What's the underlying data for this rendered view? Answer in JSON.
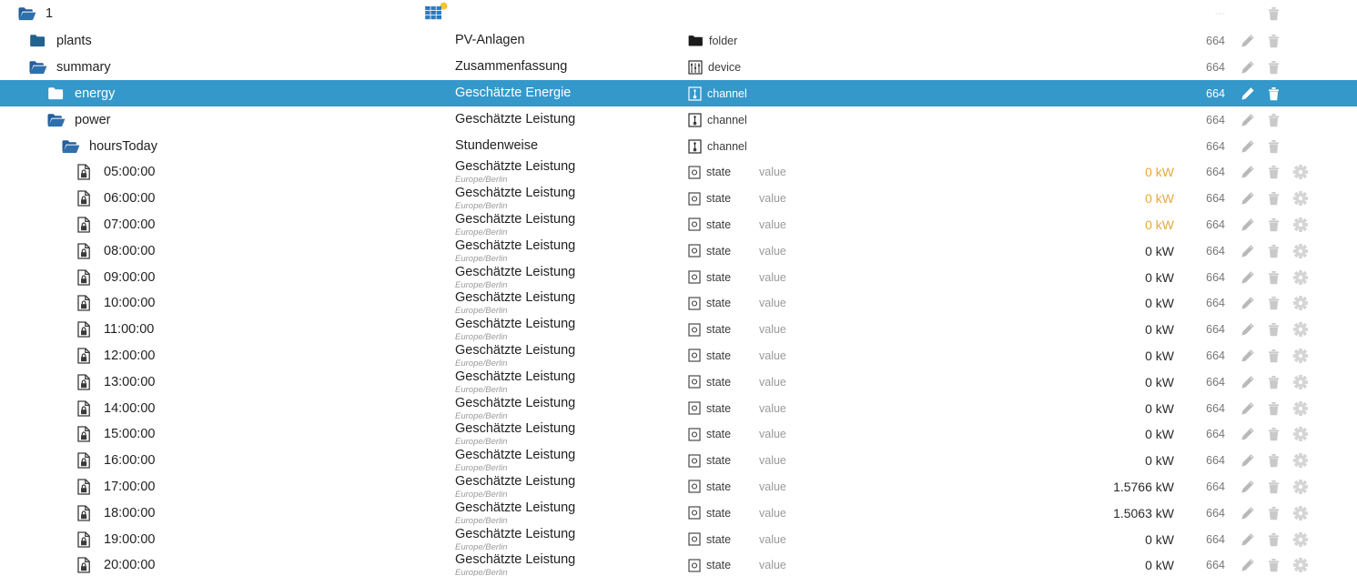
{
  "app": {
    "accent_color": "#3498ca",
    "warn_color": "#e8a83c",
    "folder_color": "#2a6099",
    "folder_open_color": "#1f5fa9"
  },
  "columns": {
    "tree": "",
    "name": "",
    "type": "",
    "role": "",
    "value": "",
    "id": "",
    "actions": ""
  },
  "header": {
    "title": "1",
    "icon": "solar-panel-icon",
    "id": "---"
  },
  "rows": [
    {
      "tree_label": "1",
      "indent": 0,
      "icon": "folder-open-icon",
      "name": "",
      "tz": "",
      "type": "",
      "type_icon": "",
      "role": "",
      "value": "",
      "id": "---",
      "id_faint": true,
      "selected": false,
      "actions": [
        "delete"
      ],
      "header_icon": "solar-panel-icon"
    },
    {
      "tree_label": "plants",
      "indent": 1,
      "icon": "folder-closed-icon",
      "name": "PV-Anlagen",
      "tz": "",
      "type": "folder",
      "type_icon": "folder-black-icon",
      "role": "",
      "value": "",
      "id": "664",
      "id_faint": false,
      "selected": false,
      "actions": [
        "edit",
        "delete"
      ]
    },
    {
      "tree_label": "summary",
      "indent": 1,
      "icon": "folder-open-icon",
      "name": "Zusammenfassung",
      "tz": "",
      "type": "device",
      "type_icon": "device-icon",
      "role": "",
      "value": "",
      "id": "664",
      "id_faint": false,
      "selected": false,
      "actions": [
        "edit",
        "delete"
      ]
    },
    {
      "tree_label": "energy",
      "indent": 2,
      "icon": "folder-closed-icon",
      "name": "Geschätzte Energie",
      "tz": "",
      "type": "channel",
      "type_icon": "channel-icon",
      "role": "",
      "value": "",
      "id": "664",
      "id_faint": false,
      "selected": true,
      "actions": [
        "edit",
        "delete"
      ]
    },
    {
      "tree_label": "power",
      "indent": 2,
      "icon": "folder-open-icon",
      "name": "Geschätzte Leistung",
      "tz": "",
      "type": "channel",
      "type_icon": "channel-icon",
      "role": "",
      "value": "",
      "id": "664",
      "id_faint": false,
      "selected": false,
      "actions": [
        "edit",
        "delete"
      ]
    },
    {
      "tree_label": "hoursToday",
      "indent": 3,
      "icon": "folder-open-icon",
      "name": "Stundenweise",
      "tz": "",
      "type": "channel",
      "type_icon": "channel-icon",
      "role": "",
      "value": "",
      "id": "664",
      "id_faint": false,
      "selected": false,
      "actions": [
        "edit",
        "delete"
      ]
    },
    {
      "tree_label": "05:00:00",
      "indent": 4,
      "icon": "state-locked-icon",
      "name": "Geschätzte Leistung",
      "tz": "Europe/Berlin",
      "type": "state",
      "type_icon": "state-icon",
      "role": "value",
      "value": "0 kW",
      "value_warn": true,
      "id": "664",
      "id_faint": false,
      "selected": false,
      "actions": [
        "edit",
        "delete",
        "settings"
      ]
    },
    {
      "tree_label": "06:00:00",
      "indent": 4,
      "icon": "state-locked-icon",
      "name": "Geschätzte Leistung",
      "tz": "Europe/Berlin",
      "type": "state",
      "type_icon": "state-icon",
      "role": "value",
      "value": "0 kW",
      "value_warn": true,
      "id": "664",
      "id_faint": false,
      "selected": false,
      "actions": [
        "edit",
        "delete",
        "settings"
      ]
    },
    {
      "tree_label": "07:00:00",
      "indent": 4,
      "icon": "state-locked-icon",
      "name": "Geschätzte Leistung",
      "tz": "Europe/Berlin",
      "type": "state",
      "type_icon": "state-icon",
      "role": "value",
      "value": "0 kW",
      "value_warn": true,
      "id": "664",
      "id_faint": false,
      "selected": false,
      "actions": [
        "edit",
        "delete",
        "settings"
      ]
    },
    {
      "tree_label": "08:00:00",
      "indent": 4,
      "icon": "state-locked-icon",
      "name": "Geschätzte Leistung",
      "tz": "Europe/Berlin",
      "type": "state",
      "type_icon": "state-icon",
      "role": "value",
      "value": "0 kW",
      "value_warn": false,
      "id": "664",
      "id_faint": false,
      "selected": false,
      "actions": [
        "edit",
        "delete",
        "settings"
      ]
    },
    {
      "tree_label": "09:00:00",
      "indent": 4,
      "icon": "state-locked-icon",
      "name": "Geschätzte Leistung",
      "tz": "Europe/Berlin",
      "type": "state",
      "type_icon": "state-icon",
      "role": "value",
      "value": "0 kW",
      "value_warn": false,
      "id": "664",
      "id_faint": false,
      "selected": false,
      "actions": [
        "edit",
        "delete",
        "settings"
      ]
    },
    {
      "tree_label": "10:00:00",
      "indent": 4,
      "icon": "state-locked-icon",
      "name": "Geschätzte Leistung",
      "tz": "Europe/Berlin",
      "type": "state",
      "type_icon": "state-icon",
      "role": "value",
      "value": "0 kW",
      "value_warn": false,
      "id": "664",
      "id_faint": false,
      "selected": false,
      "actions": [
        "edit",
        "delete",
        "settings"
      ]
    },
    {
      "tree_label": "11:00:00",
      "indent": 4,
      "icon": "state-locked-icon",
      "name": "Geschätzte Leistung",
      "tz": "Europe/Berlin",
      "type": "state",
      "type_icon": "state-icon",
      "role": "value",
      "value": "0 kW",
      "value_warn": false,
      "id": "664",
      "id_faint": false,
      "selected": false,
      "actions": [
        "edit",
        "delete",
        "settings"
      ]
    },
    {
      "tree_label": "12:00:00",
      "indent": 4,
      "icon": "state-locked-icon",
      "name": "Geschätzte Leistung",
      "tz": "Europe/Berlin",
      "type": "state",
      "type_icon": "state-icon",
      "role": "value",
      "value": "0 kW",
      "value_warn": false,
      "id": "664",
      "id_faint": false,
      "selected": false,
      "actions": [
        "edit",
        "delete",
        "settings"
      ]
    },
    {
      "tree_label": "13:00:00",
      "indent": 4,
      "icon": "state-locked-icon",
      "name": "Geschätzte Leistung",
      "tz": "Europe/Berlin",
      "type": "state",
      "type_icon": "state-icon",
      "role": "value",
      "value": "0 kW",
      "value_warn": false,
      "id": "664",
      "id_faint": false,
      "selected": false,
      "actions": [
        "edit",
        "delete",
        "settings"
      ]
    },
    {
      "tree_label": "14:00:00",
      "indent": 4,
      "icon": "state-locked-icon",
      "name": "Geschätzte Leistung",
      "tz": "Europe/Berlin",
      "type": "state",
      "type_icon": "state-icon",
      "role": "value",
      "value": "0 kW",
      "value_warn": false,
      "id": "664",
      "id_faint": false,
      "selected": false,
      "actions": [
        "edit",
        "delete",
        "settings"
      ]
    },
    {
      "tree_label": "15:00:00",
      "indent": 4,
      "icon": "state-locked-icon",
      "name": "Geschätzte Leistung",
      "tz": "Europe/Berlin",
      "type": "state",
      "type_icon": "state-icon",
      "role": "value",
      "value": "0 kW",
      "value_warn": false,
      "id": "664",
      "id_faint": false,
      "selected": false,
      "actions": [
        "edit",
        "delete",
        "settings"
      ]
    },
    {
      "tree_label": "16:00:00",
      "indent": 4,
      "icon": "state-locked-icon",
      "name": "Geschätzte Leistung",
      "tz": "Europe/Berlin",
      "type": "state",
      "type_icon": "state-icon",
      "role": "value",
      "value": "0 kW",
      "value_warn": false,
      "id": "664",
      "id_faint": false,
      "selected": false,
      "actions": [
        "edit",
        "delete",
        "settings"
      ]
    },
    {
      "tree_label": "17:00:00",
      "indent": 4,
      "icon": "state-locked-icon",
      "name": "Geschätzte Leistung",
      "tz": "Europe/Berlin",
      "type": "state",
      "type_icon": "state-icon",
      "role": "value",
      "value": "1.5766 kW",
      "value_warn": false,
      "id": "664",
      "id_faint": false,
      "selected": false,
      "actions": [
        "edit",
        "delete",
        "settings"
      ]
    },
    {
      "tree_label": "18:00:00",
      "indent": 4,
      "icon": "state-locked-icon",
      "name": "Geschätzte Leistung",
      "tz": "Europe/Berlin",
      "type": "state",
      "type_icon": "state-icon",
      "role": "value",
      "value": "1.5063 kW",
      "value_warn": false,
      "id": "664",
      "id_faint": false,
      "selected": false,
      "actions": [
        "edit",
        "delete",
        "settings"
      ]
    },
    {
      "tree_label": "19:00:00",
      "indent": 4,
      "icon": "state-locked-icon",
      "name": "Geschätzte Leistung",
      "tz": "Europe/Berlin",
      "type": "state",
      "type_icon": "state-icon",
      "role": "value",
      "value": "0 kW",
      "value_warn": false,
      "id": "664",
      "id_faint": false,
      "selected": false,
      "actions": [
        "edit",
        "delete",
        "settings"
      ]
    },
    {
      "tree_label": "20:00:00",
      "indent": 4,
      "icon": "state-locked-icon",
      "name": "Geschätzte Leistung",
      "tz": "Europe/Berlin",
      "type": "state",
      "type_icon": "state-icon",
      "role": "value",
      "value": "0 kW",
      "value_warn": false,
      "id": "664",
      "id_faint": false,
      "selected": false,
      "actions": [
        "edit",
        "delete",
        "settings"
      ]
    }
  ]
}
